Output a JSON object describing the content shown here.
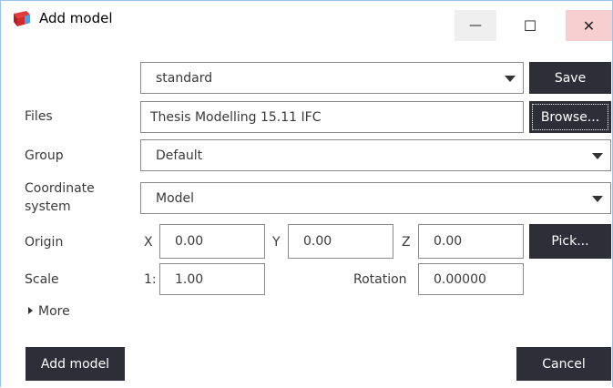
{
  "window": {
    "title": "Add model",
    "buttons": {
      "minimize": "—",
      "maximize": "☐",
      "close": "✕"
    }
  },
  "preset": {
    "value": "standard",
    "save_label": "Save"
  },
  "files": {
    "label": "Files",
    "value": "Thesis Modelling 15.11 IFC",
    "browse_label": "Browse..."
  },
  "group": {
    "label": "Group",
    "value": "Default"
  },
  "coordinate_system": {
    "label_line1": "Coordinate",
    "label_line2": "system",
    "value": "Model"
  },
  "origin": {
    "label": "Origin",
    "x_label": "X",
    "x_value": "0.00",
    "y_label": "Y",
    "y_value": "0.00",
    "z_label": "Z",
    "z_value": "0.00",
    "pick_label": "Pick..."
  },
  "scale": {
    "label": "Scale",
    "prefix": "1:",
    "value": "1.00",
    "rotation_label": "Rotation",
    "rotation_value": "0.00000"
  },
  "more": {
    "label": "More"
  },
  "footer": {
    "add_model_label": "Add model",
    "cancel_label": "Cancel"
  }
}
